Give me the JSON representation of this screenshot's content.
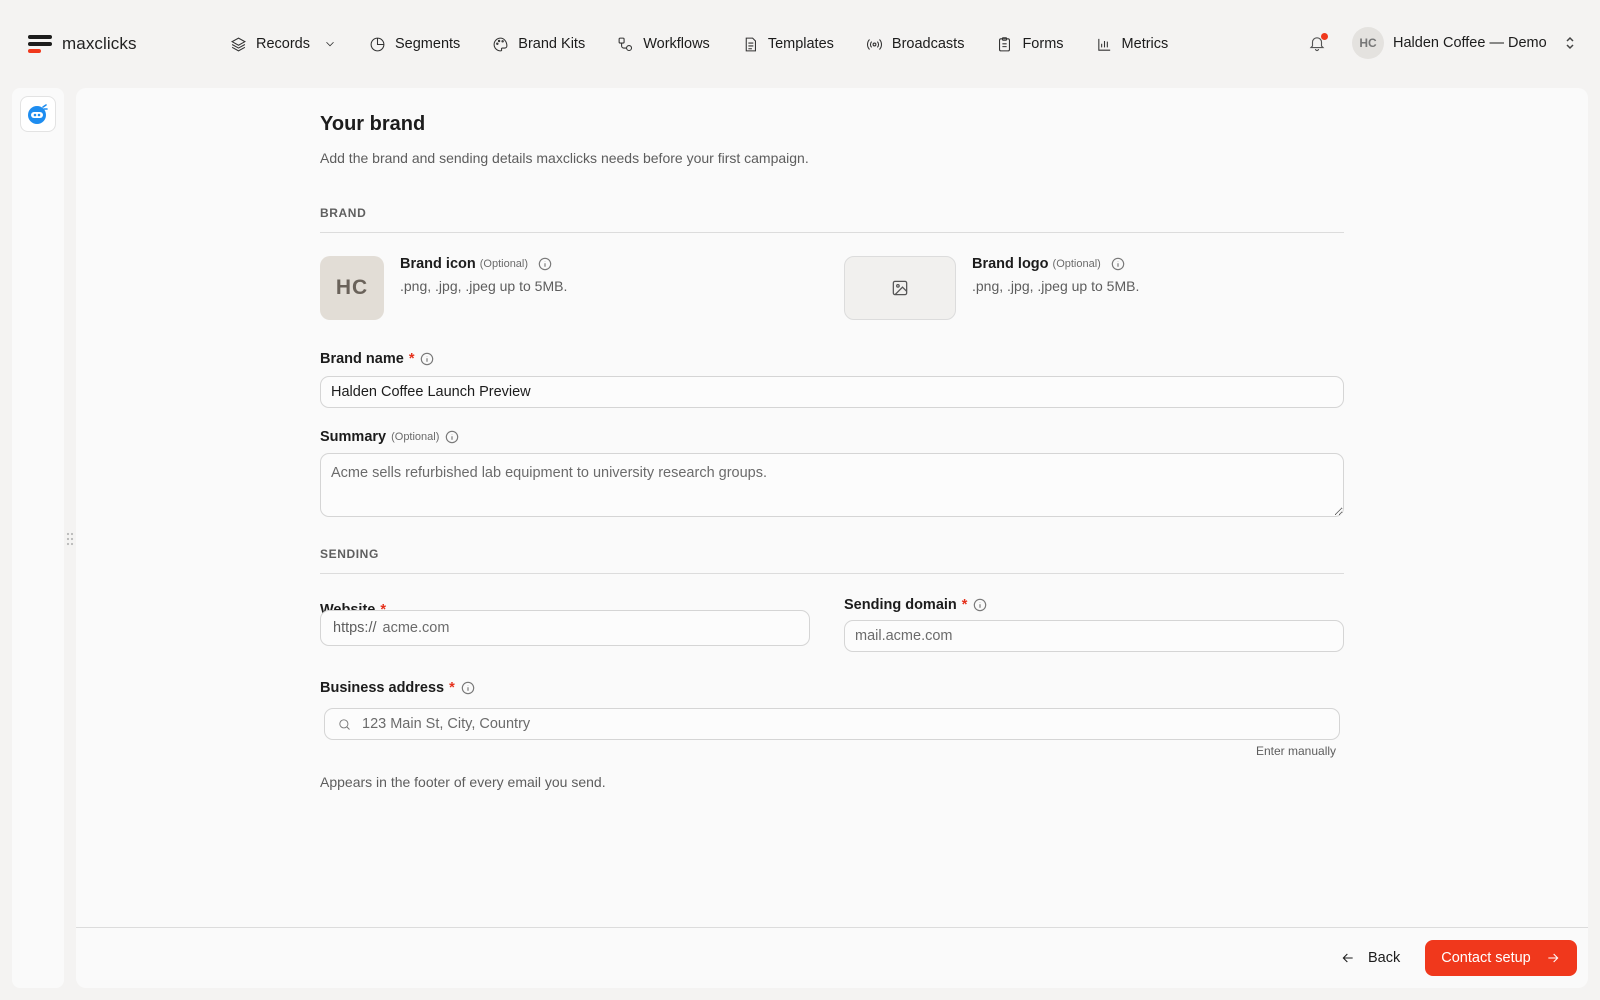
{
  "app": {
    "name": "maxclicks",
    "colors": {
      "accent": "#f0381c",
      "text": "#1c1c1c",
      "muted": "#5d5d5d",
      "panel": "#fafafa",
      "background": "#f4f3f2"
    }
  },
  "nav": {
    "items": [
      {
        "label": "Records",
        "icon": "layers-icon",
        "has_dropdown": true
      },
      {
        "label": "Segments",
        "icon": "pie-icon"
      },
      {
        "label": "Brand Kits",
        "icon": "palette-icon"
      },
      {
        "label": "Workflows",
        "icon": "workflow-icon"
      },
      {
        "label": "Templates",
        "icon": "document-icon"
      },
      {
        "label": "Broadcasts",
        "icon": "broadcast-icon"
      },
      {
        "label": "Forms",
        "icon": "clipboard-icon"
      },
      {
        "label": "Metrics",
        "icon": "bar-chart-icon"
      }
    ]
  },
  "account": {
    "initials": "HC",
    "name": "Halden Coffee — Demo",
    "has_notification": true
  },
  "page": {
    "title": "Your brand",
    "subtitle": "Add the brand and sending details maxclicks needs before your first campaign.",
    "brand_section": "BRAND",
    "sending_section": "SENDING"
  },
  "brand_icon": {
    "initials": "HC",
    "label": "Brand icon",
    "optional": "(Optional)",
    "hint": ".png, .jpg, .jpeg up to 5MB."
  },
  "brand_logo": {
    "label": "Brand logo",
    "optional": "(Optional)",
    "hint": ".png, .jpg, .jpeg up to 5MB."
  },
  "brand_name": {
    "label": "Brand name",
    "required": "*",
    "value": "Halden Coffee Launch Preview"
  },
  "summary": {
    "label": "Summary",
    "optional": "(Optional)",
    "placeholder": "Acme sells refurbished lab equipment to university research groups."
  },
  "website": {
    "label": "Website",
    "required": "*",
    "prefix": "https://",
    "placeholder": "acme.com"
  },
  "sending_domain": {
    "label": "Sending domain",
    "required": "*",
    "placeholder": "mail.acme.com"
  },
  "business_address": {
    "label": "Business address",
    "required": "*",
    "placeholder": "123 Main St, City, Country",
    "enter_manually": "Enter manually",
    "footnote": "Appears in the footer of every email you send."
  },
  "footer": {
    "back_label": "Back",
    "next_label": "Contact setup"
  }
}
